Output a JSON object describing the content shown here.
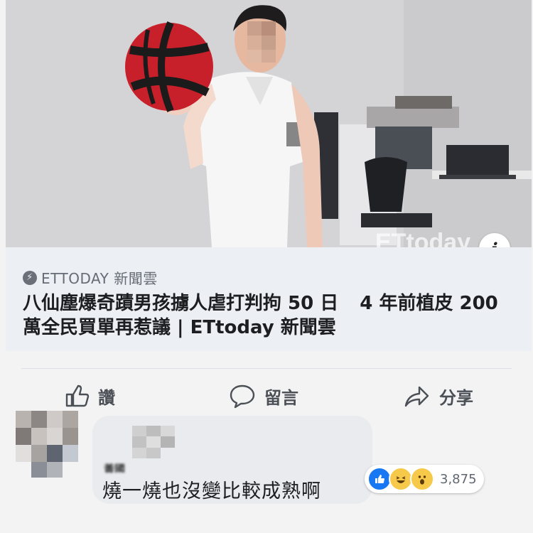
{
  "post": {
    "info_icon": "i",
    "link_card": {
      "source_icon": "lightning-icon",
      "source_name": "ETTODAY 新聞雲",
      "headline_part1": "八仙塵爆奇蹟男孩擄人虐打判拘 50 日",
      "headline_part2": "4 年前植皮 200",
      "headline_part3": "萬全民買單再惹議 | ETtoday 新聞雲"
    },
    "actions": {
      "like_label": "讚",
      "comment_label": "留言",
      "share_label": "分享"
    }
  },
  "comment": {
    "author": "黃國",
    "text": "燒一燒也沒變比較成熟啊",
    "reactions": [
      "like-icon",
      "haha-icon",
      "wow-icon"
    ],
    "reaction_count": "3,875"
  },
  "colors": {
    "card_bg": "#eceff3",
    "bubble_bg": "#e9ebee",
    "like_blue": "#1877f2",
    "reaction_yellow": "#f7c94b"
  }
}
